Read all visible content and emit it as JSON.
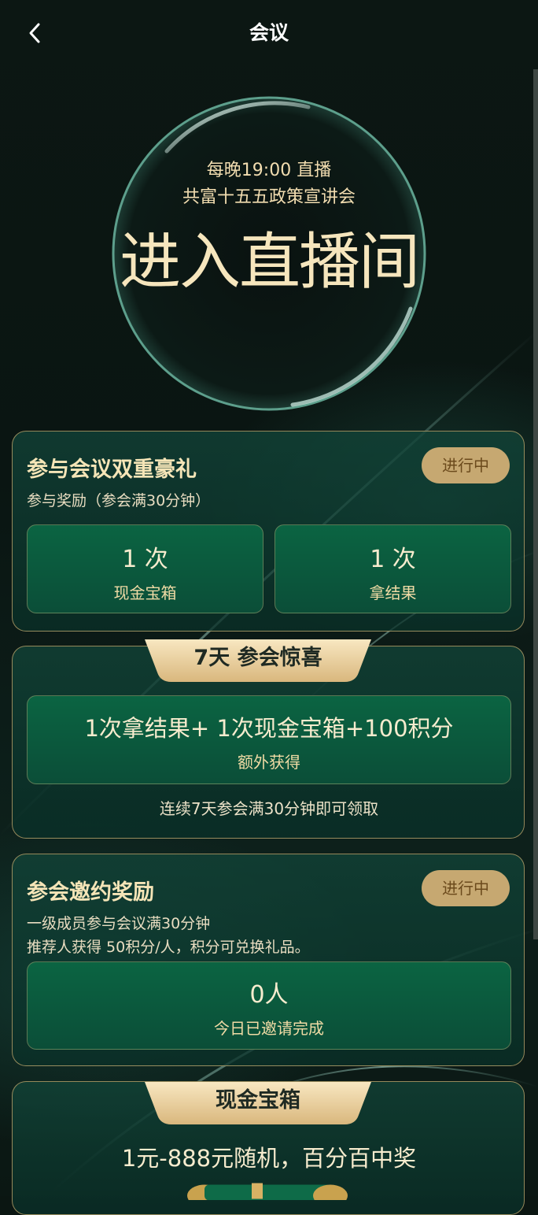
{
  "header": {
    "title": "会议",
    "back_icon": "chevron-left-icon"
  },
  "hero": {
    "line1": "每晚19:00 直播",
    "line2": "共富十五五政策宣讲会",
    "main": "进入直播间"
  },
  "card_double_gift": {
    "title": "参与会议双重豪礼",
    "status": "进行中",
    "subtitle": "参与奖励（参会满30分钟）",
    "rewards": [
      {
        "count": "1 次",
        "label": "现金宝箱"
      },
      {
        "count": "1 次",
        "label": "拿结果"
      }
    ]
  },
  "card_seven_day": {
    "ribbon": "7天 参会惊喜",
    "reward_main": "1次拿结果+ 1次现金宝箱+100积分",
    "reward_sub": "额外获得",
    "note": "连续7天参会满30分钟即可领取"
  },
  "card_invite": {
    "title": "参会邀约奖励",
    "status": "进行中",
    "desc_line1": "一级成员参与会议满30分钟",
    "desc_line2": "推荐人获得 50积分/人，积分可兑换礼品。",
    "count": "0人",
    "count_label": "今日已邀请完成"
  },
  "card_cash_box": {
    "ribbon": "现金宝箱",
    "desc": "1元-888元随机，百分百中奖"
  },
  "colors": {
    "accent_gold": "#c6a871",
    "text_gold": "#f5e5b7",
    "box_green": "#0b6442",
    "background": "#0b1612"
  }
}
